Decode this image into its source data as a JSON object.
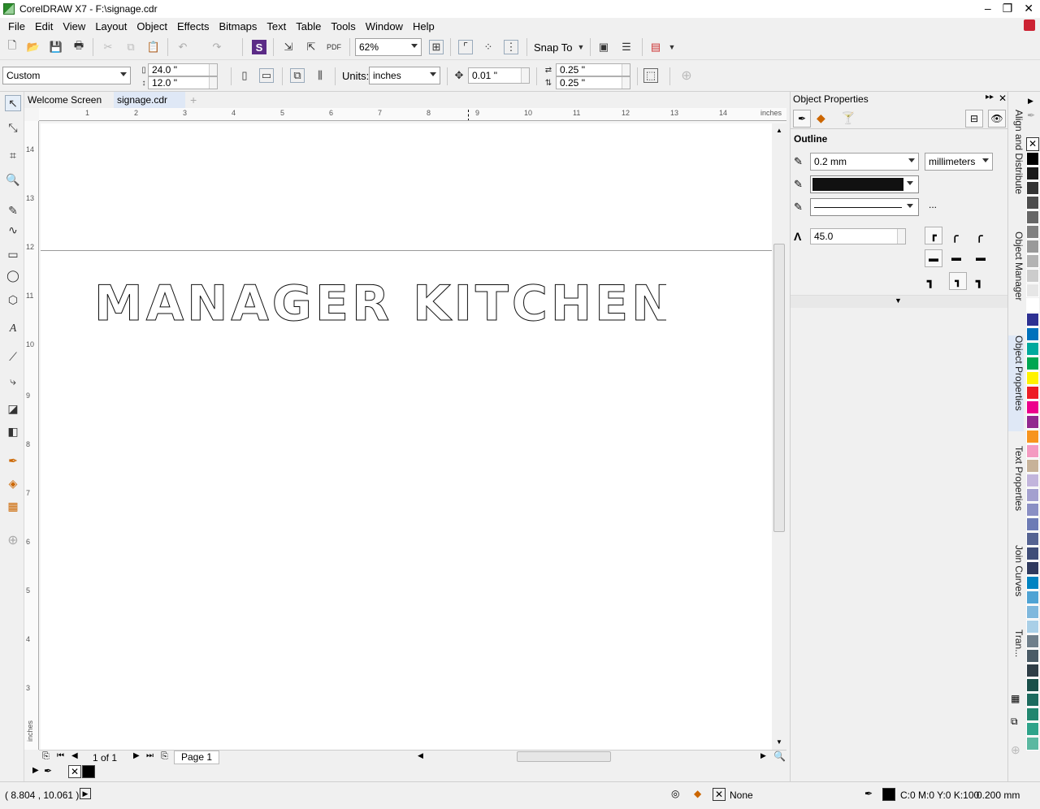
{
  "window": {
    "title": "CorelDRAW X7 - F:\\signage.cdr",
    "controls": [
      "–",
      "❐",
      "✕"
    ]
  },
  "menus": [
    "File",
    "Edit",
    "View",
    "Layout",
    "Object",
    "Effects",
    "Bitmaps",
    "Text",
    "Table",
    "Tools",
    "Window",
    "Help"
  ],
  "toolbar": {
    "zoom": "62%",
    "snap_to": "Snap To"
  },
  "propertybar": {
    "page_size": "Custom",
    "width": "24.0 \"",
    "height": "12.0 \"",
    "units_label": "Units:",
    "units": "inches",
    "nudge": "0.01 \"",
    "dup_x": "0.25 \"",
    "dup_y": "0.25 \""
  },
  "tabs": {
    "welcome": "Welcome Screen",
    "document": "signage.cdr"
  },
  "rulers": {
    "unit": "inches",
    "h_ticks": [
      "1",
      "2",
      "3",
      "4",
      "5",
      "6",
      "7",
      "8",
      "9",
      "10",
      "11",
      "12",
      "13",
      "14"
    ],
    "v_ticks": [
      "14",
      "13",
      "12",
      "11",
      "10",
      "9",
      "8",
      "7",
      "6",
      "5",
      "4",
      "3"
    ]
  },
  "canvas": {
    "text": "MANAGER KITCHEN"
  },
  "pagenav": {
    "counter": "1 of 1",
    "page_tab": "Page 1"
  },
  "docker": {
    "title": "Object Properties",
    "section": "Outline",
    "width": "0.2 mm",
    "units": "millimeters",
    "miter": "45.0",
    "more": "..."
  },
  "docker_tabs": [
    "Align and Distribute",
    "Object Manager",
    "Object Properties",
    "Text Properties",
    "Join Curves",
    "Tran..."
  ],
  "status": {
    "coords": "( 8.804 , 10.061 )",
    "fill": "None",
    "outline_color": "C:0 M:0 Y:0 K:100",
    "outline_width": "0.200 mm"
  },
  "palette": [
    "#ffffff",
    "#000000",
    "#1a1a1a",
    "#333333",
    "#4d4d4d",
    "#666666",
    "#808080",
    "#999999",
    "#b3b3b3",
    "#cccccc",
    "#e6e6e6",
    "#ffffff",
    "#2e3192",
    "#0071bc",
    "#00a99d",
    "#00a651",
    "#fff200",
    "#ed1c24",
    "#ec008c",
    "#92278f",
    "#f7941d",
    "#f49ac1",
    "#c7b299",
    "#c2b5dc",
    "#a3a0cf",
    "#8a8fc4",
    "#6d7bb5",
    "#556392",
    "#3f4d78",
    "#2f3a5e",
    "#0083c1",
    "#4fa3d4",
    "#7fb8dd",
    "#a9cfe7",
    "#6f7f8b",
    "#4a5b66",
    "#2f3e47",
    "#1a4f4a",
    "#1d6b5f",
    "#22866f",
    "#2ea38a",
    "#5bb8a1"
  ]
}
